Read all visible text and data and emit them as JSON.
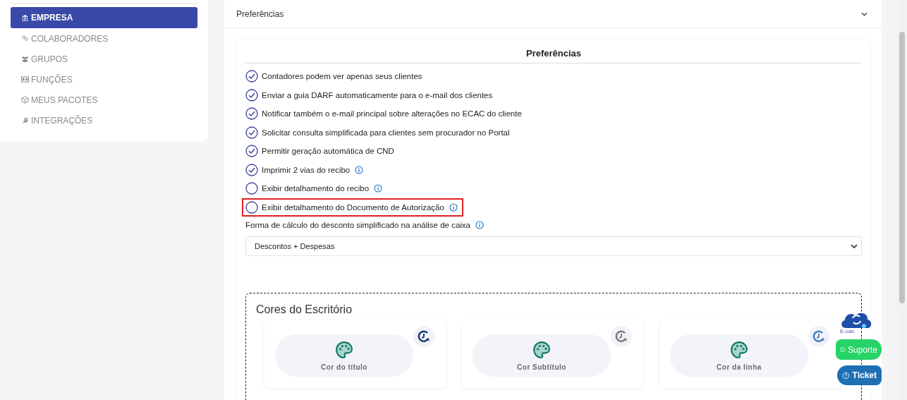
{
  "sidebar": {
    "items": [
      {
        "label": "EMPRESA",
        "selected": true
      },
      {
        "label": "COLABORADORES",
        "selected": false
      },
      {
        "label": "GRUPOS",
        "selected": false
      },
      {
        "label": "FUNÇÕES",
        "selected": false
      },
      {
        "label": "MEUS PACOTES",
        "selected": false
      },
      {
        "label": "INTEGRAÇÕES",
        "selected": false
      }
    ]
  },
  "section": {
    "title": "Preferências",
    "expanded": true
  },
  "preferences": {
    "title": "Preferências",
    "options": [
      {
        "label": "Contadores podem ver apenas seus clientes",
        "checked": true,
        "info": false,
        "highlighted": false
      },
      {
        "label": "Enviar a guia DARF automaticamente para o e-mail dos clientes",
        "checked": true,
        "info": false,
        "highlighted": false
      },
      {
        "label": "Notificar também o e-mail principal sobre alterações no ECAC do cliente",
        "checked": true,
        "info": false,
        "highlighted": false
      },
      {
        "label": "Solicitar consulta simplificada para clientes sem procurador no Portal",
        "checked": true,
        "info": false,
        "highlighted": false
      },
      {
        "label": "Permitir geração automática de CND",
        "checked": true,
        "info": false,
        "highlighted": false
      },
      {
        "label": "Imprimir 2 vias do recibo",
        "checked": true,
        "info": true,
        "highlighted": false
      },
      {
        "label": "Exibir detalhamento do recibo",
        "checked": false,
        "info": true,
        "highlighted": false
      },
      {
        "label": "Exibir detalhamento do Documento de Autorização",
        "checked": false,
        "info": true,
        "highlighted": true
      }
    ],
    "select_label": "Forma de cálculo do desconto simplificado na análise de caixa",
    "select_value": "Descontos + Despesas"
  },
  "colors": {
    "title": "Cores do Escritório",
    "items": [
      {
        "label": "Cor do título",
        "color": "#1e3a78"
      },
      {
        "label": "Cor Subtítulo",
        "color": "#7a7a7a"
      },
      {
        "label": "Cor da linha",
        "color": "#4a7ec0"
      }
    ]
  },
  "floating": {
    "ecac_label": "E-cac",
    "support": "Suporte",
    "ticket": "Ticket"
  }
}
